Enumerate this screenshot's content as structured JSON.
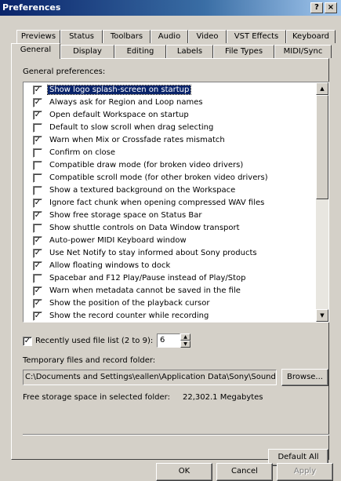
{
  "window": {
    "title": "Preferences",
    "help_label": "?",
    "close_label": "×"
  },
  "tabs_back": [
    {
      "label": "Previews"
    },
    {
      "label": "Status"
    },
    {
      "label": "Toolbars"
    },
    {
      "label": "Audio"
    },
    {
      "label": "Video"
    },
    {
      "label": "VST Effects"
    },
    {
      "label": "Keyboard"
    }
  ],
  "tabs_front": [
    {
      "label": "General",
      "active": true
    },
    {
      "label": "Display"
    },
    {
      "label": "Editing"
    },
    {
      "label": "Labels"
    },
    {
      "label": "File Types"
    },
    {
      "label": "MIDI/Sync"
    }
  ],
  "general": {
    "section_label": "General preferences:",
    "items": [
      {
        "label": "Show logo splash-screen on startup",
        "checked": true,
        "selected": true
      },
      {
        "label": "Always ask for Region and Loop names",
        "checked": true
      },
      {
        "label": "Open default Workspace on startup",
        "checked": true
      },
      {
        "label": "Default to slow scroll when drag selecting",
        "checked": false
      },
      {
        "label": "Warn when Mix or Crossfade rates mismatch",
        "checked": true
      },
      {
        "label": "Confirm on close",
        "checked": false
      },
      {
        "label": "Compatible draw mode (for broken video drivers)",
        "checked": false
      },
      {
        "label": "Compatible scroll mode (for other broken video drivers)",
        "checked": false
      },
      {
        "label": "Show a textured background on the Workspace",
        "checked": false
      },
      {
        "label": "Ignore fact chunk when opening compressed WAV files",
        "checked": true
      },
      {
        "label": "Show free storage space on Status Bar",
        "checked": true
      },
      {
        "label": "Show shuttle controls on Data Window transport",
        "checked": false
      },
      {
        "label": "Auto-power MIDI Keyboard window",
        "checked": true
      },
      {
        "label": "Use Net Notify to stay informed about Sony products",
        "checked": true
      },
      {
        "label": "Allow floating windows to dock",
        "checked": true
      },
      {
        "label": "Spacebar and F12 Play/Pause instead of Play/Stop",
        "checked": false
      },
      {
        "label": "Warn when metadata cannot be saved in the file",
        "checked": true
      },
      {
        "label": "Show the position of the playback cursor",
        "checked": true
      },
      {
        "label": "Show the record counter while recording",
        "checked": true
      }
    ],
    "recent_files": {
      "label": "Recently used file list (2 to 9):",
      "checked": true,
      "value": "6"
    },
    "temp_folder": {
      "label": "Temporary files and record folder:",
      "value": "C:\\Documents and Settings\\eallen\\Application Data\\Sony\\Sound F",
      "browse_label": "Browse..."
    },
    "free_space": {
      "label": "Free storage space in selected folder:",
      "value": "22,302.1 Megabytes"
    },
    "default_all_label": "Default All"
  },
  "footer": {
    "ok_label": "OK",
    "cancel_label": "Cancel",
    "apply_label": "Apply"
  },
  "icons": {
    "check": "✓",
    "scroll_up": "▲",
    "scroll_down": "▼"
  }
}
